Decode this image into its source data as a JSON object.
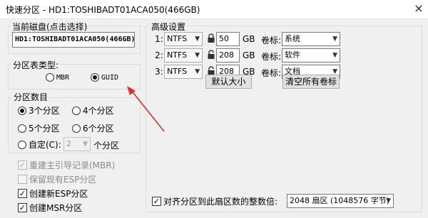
{
  "window": {
    "title": "快速分区 - HD1:TOSHIBADT01ACA050(466GB)",
    "close_glyph": "×"
  },
  "disk": {
    "group_title": "当前磁盘(点击选择)",
    "value": "HD1:TOSHIBADT01ACA050(466GB)"
  },
  "partition_table": {
    "group_title": "分区表类型:",
    "mbr_label": "MBR",
    "guid_label": "GUID",
    "selected": "GUID"
  },
  "partition_count": {
    "group_title": "分区数目",
    "opt3": "3个分区",
    "opt4": "4个分区",
    "opt5": "5个分区",
    "opt6": "6个分区",
    "custom_label": "自定(C):",
    "custom_value": "2",
    "custom_suffix": "个分区",
    "selected": "3个分区"
  },
  "options": {
    "rebuild_mbr": "重建主引导记录(MBR)",
    "keep_esp": "保留现有ESP分区",
    "create_esp": "创建新ESP分区",
    "create_msr": "创建MSR分区"
  },
  "advanced": {
    "group_title": "高级设置",
    "rows": [
      {
        "index": "1:",
        "fs": "NTFS",
        "size": "50",
        "unit": "GB",
        "label_caption": "卷标:",
        "label": "系统"
      },
      {
        "index": "2:",
        "fs": "NTFS",
        "size": "208",
        "unit": "GB",
        "label_caption": "卷标:",
        "label": "软件"
      },
      {
        "index": "3:",
        "fs": "NTFS",
        "size": "208",
        "unit": "GB",
        "label_caption": "卷标:",
        "label": "文档"
      }
    ],
    "default_size_btn": "默认大小",
    "clear_labels_btn": "清空所有卷标",
    "align_label": "对齐分区到此扇区数的整数倍:",
    "align_value": "2048 扇区 (1048576 字节)"
  },
  "colors": {
    "arrow": "#d9302a",
    "window_bg": "#f0f0f0"
  }
}
